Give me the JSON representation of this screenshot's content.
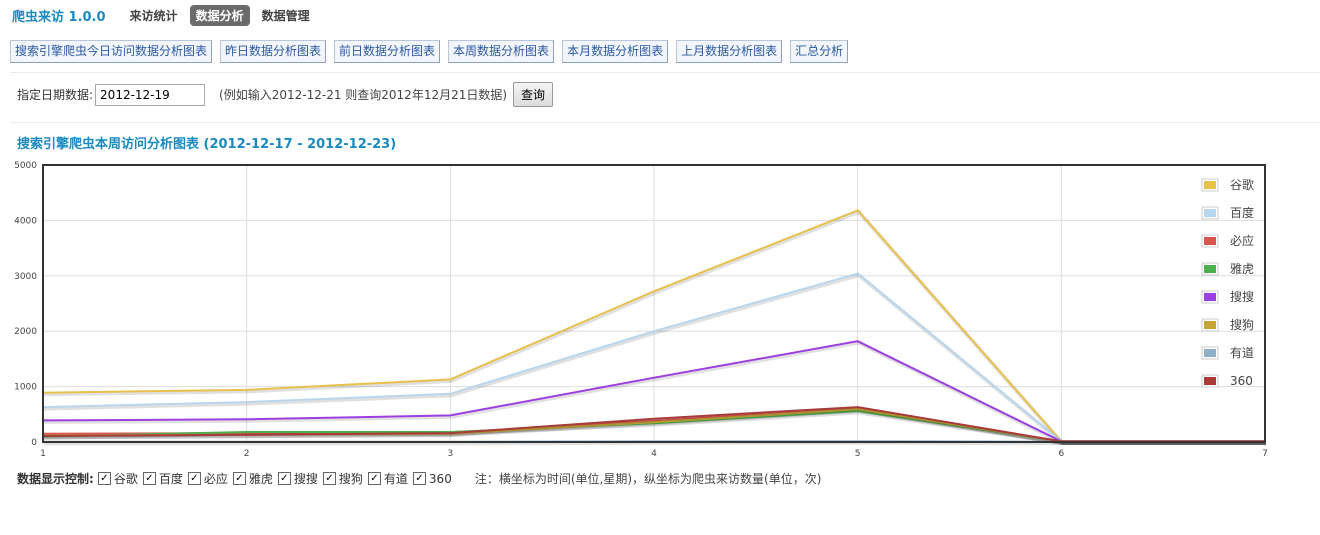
{
  "app": {
    "title": "爬虫来访 1.0.0"
  },
  "nav": [
    {
      "label": "来访统计",
      "active": false
    },
    {
      "label": "数据分析",
      "active": true
    },
    {
      "label": "数据管理",
      "active": false
    }
  ],
  "tabs": [
    "搜索引擎爬虫今日访问数据分析图表",
    "昨日数据分析图表",
    "前日数据分析图表",
    "本周数据分析图表",
    "本月数据分析图表",
    "上月数据分析图表",
    "汇总分析"
  ],
  "query": {
    "label": "指定日期数据:",
    "value": "2012-12-19",
    "hint": "(例如输入2012-12-21 则查询2012年12月21日数据)",
    "button": "查询"
  },
  "chart_title": "搜索引擎爬虫本周访问分析图表 (2012-12-17 - 2012-12-23)",
  "chart_data": {
    "type": "line",
    "x": [
      1,
      2,
      3,
      4,
      5,
      6,
      7
    ],
    "xlim": [
      1,
      7
    ],
    "ylim": [
      0,
      5000
    ],
    "yticks": [
      0,
      1000,
      2000,
      3000,
      4000,
      5000
    ],
    "grid": true,
    "legend_position": "top-right",
    "series": [
      {
        "name": "谷歌",
        "color": "#e8c04c",
        "values": [
          890,
          940,
          1130,
          2720,
          4180,
          10,
          10
        ]
      },
      {
        "name": "百度",
        "color": "#b8d6ee",
        "values": [
          630,
          720,
          870,
          2000,
          3040,
          10,
          10
        ]
      },
      {
        "name": "必应",
        "color": "#d9534f",
        "values": [
          150,
          160,
          170,
          380,
          600,
          10,
          10
        ]
      },
      {
        "name": "雅虎",
        "color": "#4caf50",
        "values": [
          100,
          180,
          180,
          340,
          560,
          10,
          10
        ]
      },
      {
        "name": "搜搜",
        "color": "#9b3fe0",
        "values": [
          390,
          410,
          480,
          1160,
          1820,
          10,
          10
        ]
      },
      {
        "name": "搜狗",
        "color": "#c4a535",
        "values": [
          120,
          130,
          150,
          360,
          590,
          10,
          10
        ]
      },
      {
        "name": "有道",
        "color": "#8fb0c8",
        "values": [
          5,
          5,
          5,
          10,
          15,
          5,
          5
        ]
      },
      {
        "name": "360",
        "color": "#a83a3a",
        "values": [
          110,
          130,
          160,
          420,
          630,
          10,
          10
        ]
      }
    ]
  },
  "controls": {
    "label": "数据显示控制:",
    "note": "注：横坐标为时间(单位,星期)，纵坐标为爬虫来访数量(单位，次)"
  }
}
